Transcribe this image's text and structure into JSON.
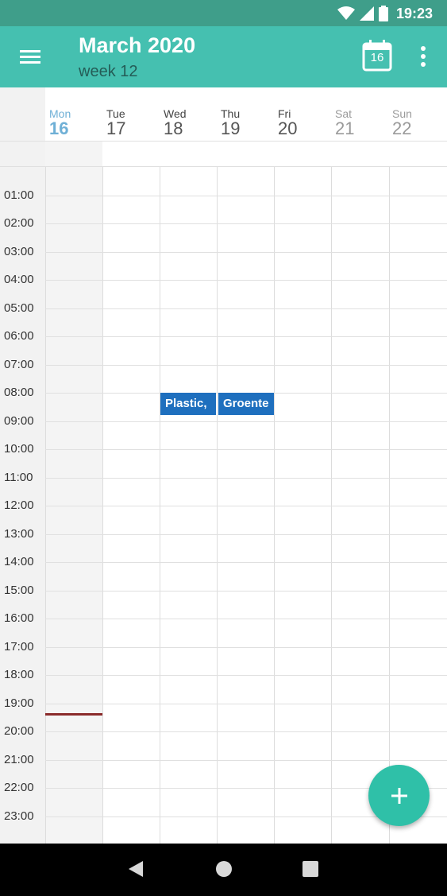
{
  "status_bar": {
    "time": "19:23",
    "icons": [
      "wifi-icon",
      "signal-icon",
      "battery-icon"
    ]
  },
  "app_bar": {
    "title": "March 2020",
    "subtitle": "week 12",
    "today_badge": "16",
    "icons": [
      "menu-icon",
      "calendar-today-icon",
      "overflow-menu-icon"
    ]
  },
  "days": [
    {
      "name": "Mon",
      "num": "16",
      "state": "today"
    },
    {
      "name": "Tue",
      "num": "17",
      "state": "weekday"
    },
    {
      "name": "Wed",
      "num": "18",
      "state": "weekday"
    },
    {
      "name": "Thu",
      "num": "19",
      "state": "weekday"
    },
    {
      "name": "Fri",
      "num": "20",
      "state": "weekday"
    },
    {
      "name": "Sat",
      "num": "21",
      "state": "weekend"
    },
    {
      "name": "Sun",
      "num": "22",
      "state": "weekend"
    }
  ],
  "hours": [
    "01:00",
    "02:00",
    "03:00",
    "04:00",
    "05:00",
    "06:00",
    "07:00",
    "08:00",
    "09:00",
    "10:00",
    "11:00",
    "12:00",
    "13:00",
    "14:00",
    "15:00",
    "16:00",
    "17:00",
    "18:00",
    "19:00",
    "20:00",
    "21:00",
    "22:00",
    "23:00"
  ],
  "events": [
    {
      "title": "Plastic,",
      "day": "Wed",
      "start": "08:00"
    },
    {
      "title": "Groente",
      "day": "Thu",
      "start": "08:00"
    }
  ],
  "colors": {
    "status_bar": "#3f9e8a",
    "app_bar": "#45c0b0",
    "today": "#6fb0d6",
    "event": "#1e6fbe",
    "now_line": "#8a2a2a",
    "fab": "#2fc0a8"
  },
  "fab": {
    "icon": "plus-icon"
  },
  "nav_bar": {
    "icons": [
      "back-icon",
      "home-icon",
      "recents-icon"
    ]
  }
}
